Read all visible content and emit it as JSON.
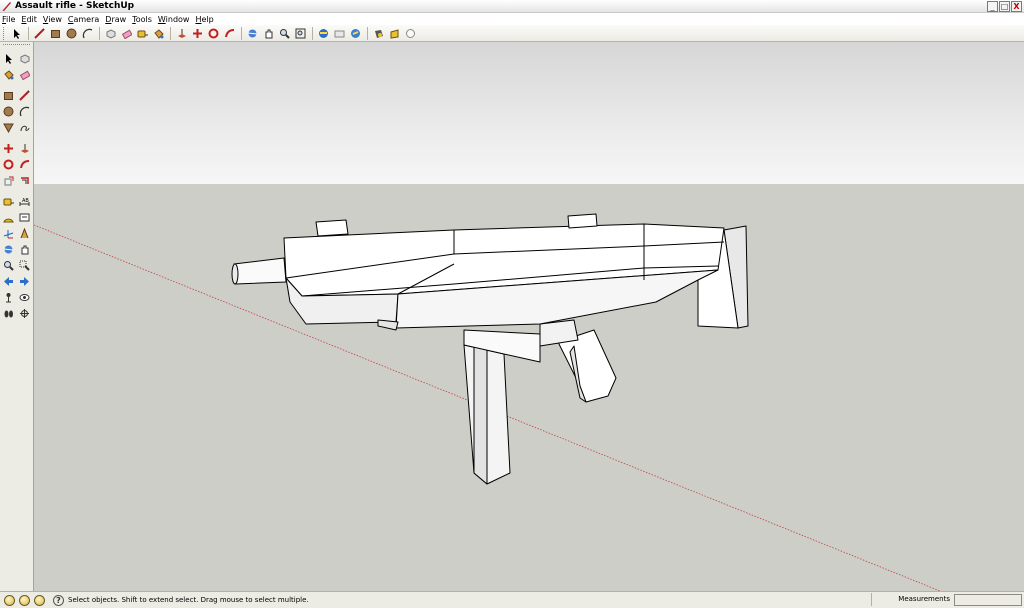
{
  "window": {
    "title": "Assault rifle - SketchUp",
    "buttons": {
      "minimize": "_",
      "maximize": "□",
      "close": "X"
    }
  },
  "menu": [
    {
      "label": "File",
      "name": "menu-file"
    },
    {
      "label": "Edit",
      "name": "menu-edit"
    },
    {
      "label": "View",
      "name": "menu-view"
    },
    {
      "label": "Camera",
      "name": "menu-camera"
    },
    {
      "label": "Draw",
      "name": "menu-draw"
    },
    {
      "label": "Tools",
      "name": "menu-tools"
    },
    {
      "label": "Window",
      "name": "menu-window"
    },
    {
      "label": "Help",
      "name": "menu-help"
    }
  ],
  "toolbar": {
    "tools": [
      "select-icon",
      "sep",
      "line-icon",
      "rectangle-icon",
      "circle-icon",
      "arc-icon",
      "sep",
      "make-component-icon",
      "eraser-icon",
      "tape-measure-icon",
      "paint-bucket-icon",
      "sep",
      "push-pull-icon",
      "move-icon",
      "rotate-icon",
      "follow-me-icon",
      "sep",
      "orbit-icon",
      "pan-icon",
      "zoom-icon",
      "zoom-extents-icon",
      "sep",
      "get-models-icon",
      "share-model-icon",
      "share-component-icon",
      "sep",
      "google-earth-icon",
      "photo-textures-icon",
      "google-3d-icon"
    ]
  },
  "left_toolbar": {
    "rows": [
      [
        "select-icon",
        "make-component-icon"
      ],
      [
        "paint-bucket-icon",
        "eraser-icon"
      ],
      [
        "gap"
      ],
      [
        "rectangle-icon",
        "line-icon"
      ],
      [
        "circle-icon",
        "arc-icon"
      ],
      [
        "polygon-icon",
        "freehand-icon"
      ],
      [
        "gap"
      ],
      [
        "move-icon",
        "push-pull-icon"
      ],
      [
        "rotate-icon",
        "follow-me-icon"
      ],
      [
        "scale-icon",
        "offset-icon"
      ],
      [
        "gap"
      ],
      [
        "tape-measure-icon",
        "dimension-icon"
      ],
      [
        "protractor-icon",
        "text-icon"
      ],
      [
        "axes-icon",
        "3d-text-icon"
      ],
      [
        "orbit-icon",
        "pan-icon"
      ],
      [
        "zoom-icon",
        "zoom-window-icon"
      ],
      [
        "previous-view-icon",
        "next-view-icon"
      ],
      [
        "position-camera-icon",
        "look-around-icon"
      ],
      [
        "walk-icon",
        "section-plane-icon"
      ]
    ]
  },
  "status": {
    "text": "Select objects. Shift to extend select. Drag mouse to select multiple.",
    "measurements_label": "Measurements",
    "measurements_value": ""
  },
  "colors": {
    "sky_top": "#d6d6d6",
    "sky_bottom": "#f6f6f6",
    "ground": "#cecec9",
    "model_face": "#ffffff",
    "model_shade": "#ededed",
    "model_edge": "#000000",
    "axis_red": "#c04040"
  }
}
